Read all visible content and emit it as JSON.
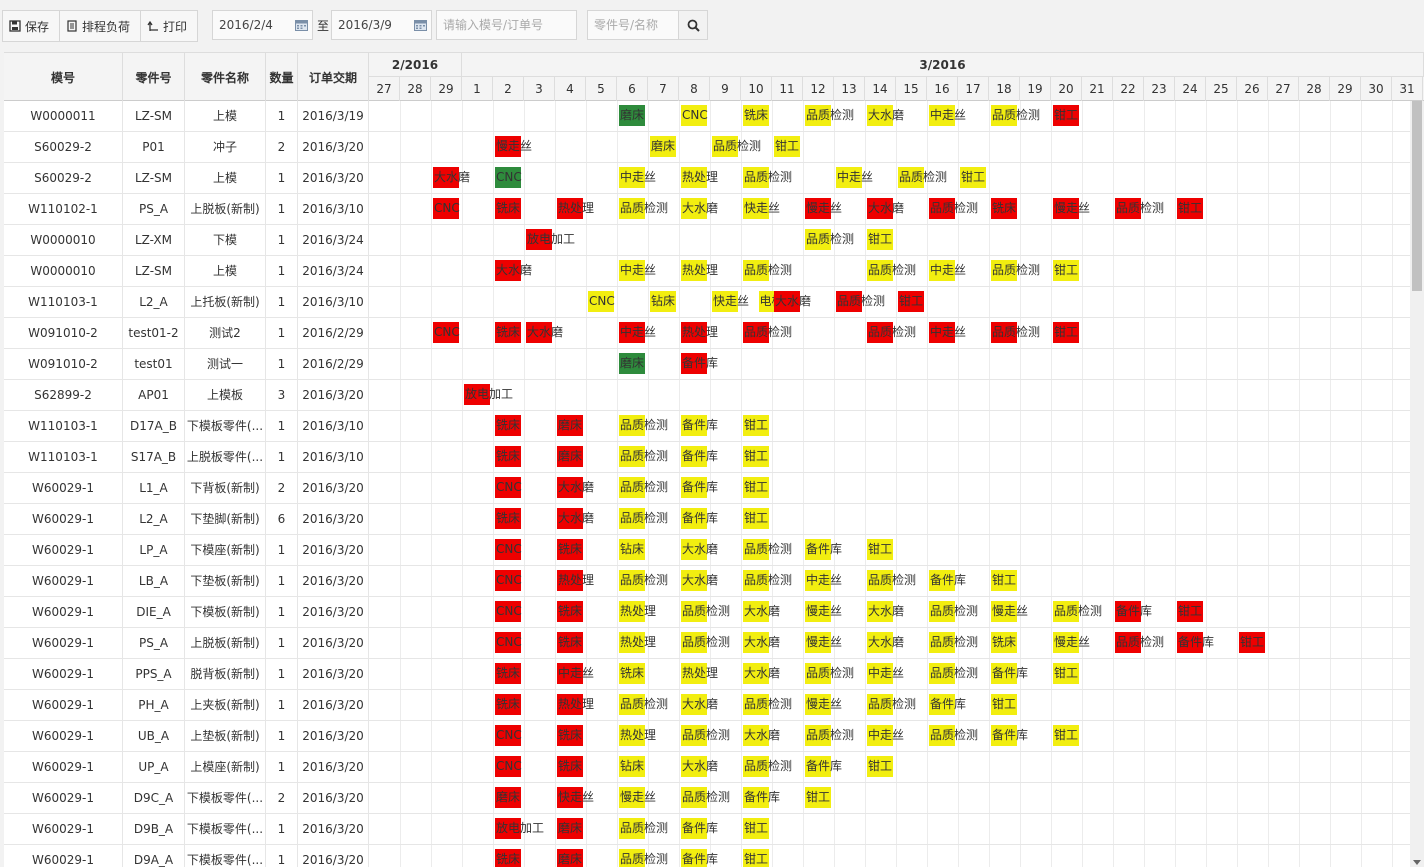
{
  "toolbar": {
    "save": "保存",
    "load": "排程负荷",
    "print": "打印",
    "start_date": "2016/2/4",
    "to": "至",
    "end_date": "2016/3/9",
    "mold_placeholder": "请输入模号/订单号",
    "part_placeholder": "零件号/名称"
  },
  "columns": {
    "mold": "模号",
    "part_no": "零件号",
    "part_name": "零件名称",
    "qty": "数量",
    "due": "订单交期"
  },
  "months": [
    "2/2016",
    "3/2016"
  ],
  "days": [
    "27",
    "28",
    "29",
    "1",
    "2",
    "3",
    "4",
    "5",
    "6",
    "7",
    "8",
    "9",
    "10",
    "11",
    "12",
    "13",
    "14",
    "15",
    "16",
    "17",
    "18",
    "19",
    "20",
    "21",
    "22",
    "23",
    "24",
    "25",
    "26",
    "27",
    "28",
    "29",
    "30",
    "31"
  ],
  "colors": {
    "red": "#ee0000",
    "yellow": "#f2ee10",
    "green": "#2e8b3c"
  },
  "rows": [
    {
      "mold": "W0000011",
      "part_no": "LZ-SM",
      "part_name": "上模",
      "qty": "1",
      "due": "2016/3/19",
      "tasks": [
        [
          8,
          "磨床",
          "green"
        ],
        [
          10,
          "CNC",
          "yellow"
        ],
        [
          12,
          "铣床",
          "yellow"
        ],
        [
          14,
          "品质检测",
          "yellow"
        ],
        [
          16,
          "大水磨",
          "yellow"
        ],
        [
          18,
          "中走丝",
          "yellow"
        ],
        [
          20,
          "品质检测",
          "yellow"
        ],
        [
          22,
          "钳工",
          "red"
        ]
      ]
    },
    {
      "mold": "S60029-2",
      "part_no": "P01",
      "part_name": "冲子",
      "qty": "2",
      "due": "2016/3/20",
      "tasks": [
        [
          4,
          "慢走丝",
          "red"
        ],
        [
          9,
          "磨床",
          "yellow"
        ],
        [
          11,
          "品质检测",
          "yellow"
        ],
        [
          13,
          "钳工",
          "yellow"
        ]
      ]
    },
    {
      "mold": "S60029-2",
      "part_no": "LZ-SM",
      "part_name": "上模",
      "qty": "1",
      "due": "2016/3/20",
      "tasks": [
        [
          2,
          "大水磨",
          "red"
        ],
        [
          4,
          "CNC",
          "green"
        ],
        [
          8,
          "中走丝",
          "yellow"
        ],
        [
          10,
          "热处理",
          "yellow"
        ],
        [
          12,
          "品质检测",
          "yellow"
        ],
        [
          15,
          "中走丝",
          "yellow"
        ],
        [
          17,
          "品质检测",
          "yellow"
        ],
        [
          19,
          "钳工",
          "yellow"
        ]
      ]
    },
    {
      "mold": "W110102-1",
      "part_no": "PS_A",
      "part_name": "上脱板(新制)",
      "qty": "1",
      "due": "2016/3/10",
      "tasks": [
        [
          2,
          "CNC",
          "red"
        ],
        [
          4,
          "铣床",
          "red"
        ],
        [
          6,
          "热处理",
          "red"
        ],
        [
          8,
          "品质检测",
          "yellow"
        ],
        [
          10,
          "大水磨",
          "yellow"
        ],
        [
          12,
          "快走丝",
          "yellow"
        ],
        [
          14,
          "慢走丝",
          "red"
        ],
        [
          16,
          "大水磨",
          "red"
        ],
        [
          18,
          "品质检测",
          "red"
        ],
        [
          20,
          "铣床",
          "red"
        ],
        [
          22,
          "慢走丝",
          "red"
        ],
        [
          24,
          "品质检测",
          "red"
        ],
        [
          26,
          "钳工",
          "red"
        ]
      ]
    },
    {
      "mold": "W0000010",
      "part_no": "LZ-XM",
      "part_name": "下模",
      "qty": "1",
      "due": "2016/3/24",
      "tasks": [
        [
          5,
          "放电加工",
          "red"
        ],
        [
          14,
          "品质检测",
          "yellow"
        ],
        [
          16,
          "钳工",
          "yellow"
        ]
      ]
    },
    {
      "mold": "W0000010",
      "part_no": "LZ-SM",
      "part_name": "上模",
      "qty": "1",
      "due": "2016/3/24",
      "tasks": [
        [
          4,
          "大水磨",
          "red"
        ],
        [
          8,
          "中走丝",
          "yellow"
        ],
        [
          10,
          "热处理",
          "yellow"
        ],
        [
          12,
          "品质检测",
          "yellow"
        ],
        [
          16,
          "品质检测",
          "yellow"
        ],
        [
          18,
          "中走丝",
          "yellow"
        ],
        [
          20,
          "品质检测",
          "yellow"
        ],
        [
          22,
          "钳工",
          "yellow"
        ]
      ]
    },
    {
      "mold": "W110103-1",
      "part_no": "L2_A",
      "part_name": "上托板(新制)",
      "qty": "1",
      "due": "2016/3/10",
      "tasks": [
        [
          7,
          "CNC",
          "yellow"
        ],
        [
          9,
          "钻床",
          "yellow"
        ],
        [
          11,
          "快走丝",
          "yellow"
        ],
        [
          12.5,
          "电极",
          "yellow"
        ],
        [
          13,
          "大水磨",
          "red"
        ],
        [
          15,
          "品质检测",
          "red"
        ],
        [
          17,
          "钳工",
          "red"
        ]
      ]
    },
    {
      "mold": "W091010-2",
      "part_no": "test01-2",
      "part_name": "测试2",
      "qty": "1",
      "due": "2016/2/29",
      "tasks": [
        [
          2,
          "CNC",
          "red"
        ],
        [
          4,
          "铣床",
          "red"
        ],
        [
          5,
          "大水磨",
          "red"
        ],
        [
          8,
          "中走丝",
          "red"
        ],
        [
          10,
          "热处理",
          "red"
        ],
        [
          12,
          "品质检测",
          "red"
        ],
        [
          16,
          "品质检测",
          "red"
        ],
        [
          18,
          "中走丝",
          "red"
        ],
        [
          20,
          "品质检测",
          "red"
        ],
        [
          22,
          "钳工",
          "red"
        ]
      ]
    },
    {
      "mold": "W091010-2",
      "part_no": "test01",
      "part_name": "测试一",
      "qty": "1",
      "due": "2016/2/29",
      "tasks": [
        [
          8,
          "磨床",
          "green"
        ],
        [
          10,
          "备件库",
          "red"
        ]
      ]
    },
    {
      "mold": "S62899-2",
      "part_no": "AP01",
      "part_name": "上模板",
      "qty": "3",
      "due": "2016/3/20",
      "tasks": [
        [
          3,
          "放电加工",
          "red"
        ]
      ]
    },
    {
      "mold": "W110103-1",
      "part_no": "D17A_B",
      "part_name": "下模板零件(...",
      "qty": "1",
      "due": "2016/3/10",
      "tasks": [
        [
          4,
          "铣床",
          "red"
        ],
        [
          6,
          "磨床",
          "red"
        ],
        [
          8,
          "品质检测",
          "yellow"
        ],
        [
          10,
          "备件库",
          "yellow"
        ],
        [
          12,
          "钳工",
          "yellow"
        ]
      ]
    },
    {
      "mold": "W110103-1",
      "part_no": "S17A_B",
      "part_name": "上脱板零件(...",
      "qty": "1",
      "due": "2016/3/10",
      "tasks": [
        [
          4,
          "铣床",
          "red"
        ],
        [
          6,
          "磨床",
          "red"
        ],
        [
          8,
          "品质检测",
          "yellow"
        ],
        [
          10,
          "备件库",
          "yellow"
        ],
        [
          12,
          "钳工",
          "yellow"
        ]
      ]
    },
    {
      "mold": "W60029-1",
      "part_no": "L1_A",
      "part_name": "下背板(新制)",
      "qty": "2",
      "due": "2016/3/20",
      "tasks": [
        [
          4,
          "CNC",
          "red"
        ],
        [
          6,
          "大水磨",
          "red"
        ],
        [
          8,
          "品质检测",
          "yellow"
        ],
        [
          10,
          "备件库",
          "yellow"
        ],
        [
          12,
          "钳工",
          "yellow"
        ]
      ]
    },
    {
      "mold": "W60029-1",
      "part_no": "L2_A",
      "part_name": "下垫脚(新制)",
      "qty": "6",
      "due": "2016/3/20",
      "tasks": [
        [
          4,
          "铣床",
          "red"
        ],
        [
          6,
          "大水磨",
          "red"
        ],
        [
          8,
          "品质检测",
          "yellow"
        ],
        [
          10,
          "备件库",
          "yellow"
        ],
        [
          12,
          "钳工",
          "yellow"
        ]
      ]
    },
    {
      "mold": "W60029-1",
      "part_no": "LP_A",
      "part_name": "下模座(新制)",
      "qty": "1",
      "due": "2016/3/20",
      "tasks": [
        [
          4,
          "CNC",
          "red"
        ],
        [
          6,
          "铣床",
          "red"
        ],
        [
          8,
          "钻床",
          "yellow"
        ],
        [
          10,
          "大水磨",
          "yellow"
        ],
        [
          12,
          "品质检测",
          "yellow"
        ],
        [
          14,
          "备件库",
          "yellow"
        ],
        [
          16,
          "钳工",
          "yellow"
        ]
      ]
    },
    {
      "mold": "W60029-1",
      "part_no": "LB_A",
      "part_name": "下垫板(新制)",
      "qty": "1",
      "due": "2016/3/20",
      "tasks": [
        [
          4,
          "CNC",
          "red"
        ],
        [
          6,
          "热处理",
          "red"
        ],
        [
          8,
          "品质检测",
          "yellow"
        ],
        [
          10,
          "大水磨",
          "yellow"
        ],
        [
          12,
          "品质检测",
          "yellow"
        ],
        [
          14,
          "中走丝",
          "yellow"
        ],
        [
          16,
          "品质检测",
          "yellow"
        ],
        [
          18,
          "备件库",
          "yellow"
        ],
        [
          20,
          "钳工",
          "yellow"
        ]
      ]
    },
    {
      "mold": "W60029-1",
      "part_no": "DIE_A",
      "part_name": "下模板(新制)",
      "qty": "1",
      "due": "2016/3/20",
      "tasks": [
        [
          4,
          "CNC",
          "red"
        ],
        [
          6,
          "铣床",
          "red"
        ],
        [
          8,
          "热处理",
          "yellow"
        ],
        [
          10,
          "品质检测",
          "yellow"
        ],
        [
          12,
          "大水磨",
          "yellow"
        ],
        [
          14,
          "慢走丝",
          "yellow"
        ],
        [
          16,
          "大水磨",
          "yellow"
        ],
        [
          18,
          "品质检测",
          "yellow"
        ],
        [
          20,
          "慢走丝",
          "yellow"
        ],
        [
          22,
          "品质检测",
          "yellow"
        ],
        [
          24,
          "备件库",
          "red"
        ],
        [
          26,
          "钳工",
          "red"
        ]
      ]
    },
    {
      "mold": "W60029-1",
      "part_no": "PS_A",
      "part_name": "上脱板(新制)",
      "qty": "1",
      "due": "2016/3/20",
      "tasks": [
        [
          4,
          "CNC",
          "red"
        ],
        [
          6,
          "铣床",
          "red"
        ],
        [
          8,
          "热处理",
          "yellow"
        ],
        [
          10,
          "品质检测",
          "yellow"
        ],
        [
          12,
          "大水磨",
          "yellow"
        ],
        [
          14,
          "慢走丝",
          "yellow"
        ],
        [
          16,
          "大水磨",
          "yellow"
        ],
        [
          18,
          "品质检测",
          "yellow"
        ],
        [
          20,
          "铣床",
          "yellow"
        ],
        [
          22,
          "慢走丝",
          "yellow"
        ],
        [
          24,
          "品质检测",
          "red"
        ],
        [
          26,
          "备件库",
          "red"
        ],
        [
          28,
          "钳工",
          "red"
        ]
      ]
    },
    {
      "mold": "W60029-1",
      "part_no": "PPS_A",
      "part_name": "脱背板(新制)",
      "qty": "1",
      "due": "2016/3/20",
      "tasks": [
        [
          4,
          "铣床",
          "red"
        ],
        [
          6,
          "中走丝",
          "red"
        ],
        [
          8,
          "铣床",
          "yellow"
        ],
        [
          10,
          "热处理",
          "yellow"
        ],
        [
          12,
          "大水磨",
          "yellow"
        ],
        [
          14,
          "品质检测",
          "yellow"
        ],
        [
          16,
          "中走丝",
          "yellow"
        ],
        [
          18,
          "品质检测",
          "yellow"
        ],
        [
          20,
          "备件库",
          "yellow"
        ],
        [
          22,
          "钳工",
          "yellow"
        ]
      ]
    },
    {
      "mold": "W60029-1",
      "part_no": "PH_A",
      "part_name": "上夹板(新制)",
      "qty": "1",
      "due": "2016/3/20",
      "tasks": [
        [
          4,
          "铣床",
          "red"
        ],
        [
          6,
          "热处理",
          "red"
        ],
        [
          8,
          "品质检测",
          "yellow"
        ],
        [
          10,
          "大水磨",
          "yellow"
        ],
        [
          12,
          "品质检测",
          "yellow"
        ],
        [
          14,
          "慢走丝",
          "yellow"
        ],
        [
          16,
          "品质检测",
          "yellow"
        ],
        [
          18,
          "备件库",
          "yellow"
        ],
        [
          20,
          "钳工",
          "yellow"
        ]
      ]
    },
    {
      "mold": "W60029-1",
      "part_no": "UB_A",
      "part_name": "上垫板(新制)",
      "qty": "1",
      "due": "2016/3/20",
      "tasks": [
        [
          4,
          "CNC",
          "red"
        ],
        [
          6,
          "铣床",
          "red"
        ],
        [
          8,
          "热处理",
          "yellow"
        ],
        [
          10,
          "品质检测",
          "yellow"
        ],
        [
          12,
          "大水磨",
          "yellow"
        ],
        [
          14,
          "品质检测",
          "yellow"
        ],
        [
          16,
          "中走丝",
          "yellow"
        ],
        [
          18,
          "品质检测",
          "yellow"
        ],
        [
          20,
          "备件库",
          "yellow"
        ],
        [
          22,
          "钳工",
          "yellow"
        ]
      ]
    },
    {
      "mold": "W60029-1",
      "part_no": "UP_A",
      "part_name": "上模座(新制)",
      "qty": "1",
      "due": "2016/3/20",
      "tasks": [
        [
          4,
          "CNC",
          "red"
        ],
        [
          6,
          "铣床",
          "red"
        ],
        [
          8,
          "钻床",
          "yellow"
        ],
        [
          10,
          "大水磨",
          "yellow"
        ],
        [
          12,
          "品质检测",
          "yellow"
        ],
        [
          14,
          "备件库",
          "yellow"
        ],
        [
          16,
          "钳工",
          "yellow"
        ]
      ]
    },
    {
      "mold": "W60029-1",
      "part_no": "D9C_A",
      "part_name": "下模板零件(...",
      "qty": "2",
      "due": "2016/3/20",
      "tasks": [
        [
          4,
          "磨床",
          "red"
        ],
        [
          6,
          "快走丝",
          "red"
        ],
        [
          8,
          "慢走丝",
          "yellow"
        ],
        [
          10,
          "品质检测",
          "yellow"
        ],
        [
          12,
          "备件库",
          "yellow"
        ],
        [
          14,
          "钳工",
          "yellow"
        ]
      ]
    },
    {
      "mold": "W60029-1",
      "part_no": "D9B_A",
      "part_name": "下模板零件(...",
      "qty": "1",
      "due": "2016/3/20",
      "tasks": [
        [
          4,
          "放电加工",
          "red"
        ],
        [
          6,
          "磨床",
          "red"
        ],
        [
          8,
          "品质检测",
          "yellow"
        ],
        [
          10,
          "备件库",
          "yellow"
        ],
        [
          12,
          "钳工",
          "yellow"
        ]
      ]
    },
    {
      "mold": "W60029-1",
      "part_no": "D9A_A",
      "part_name": "下模板零件(...",
      "qty": "1",
      "due": "2016/3/20",
      "tasks": [
        [
          4,
          "铣床",
          "red"
        ],
        [
          6,
          "磨床",
          "red"
        ],
        [
          8,
          "品质检测",
          "yellow"
        ],
        [
          10,
          "备件库",
          "yellow"
        ],
        [
          12,
          "钳工",
          "yellow"
        ]
      ]
    }
  ]
}
